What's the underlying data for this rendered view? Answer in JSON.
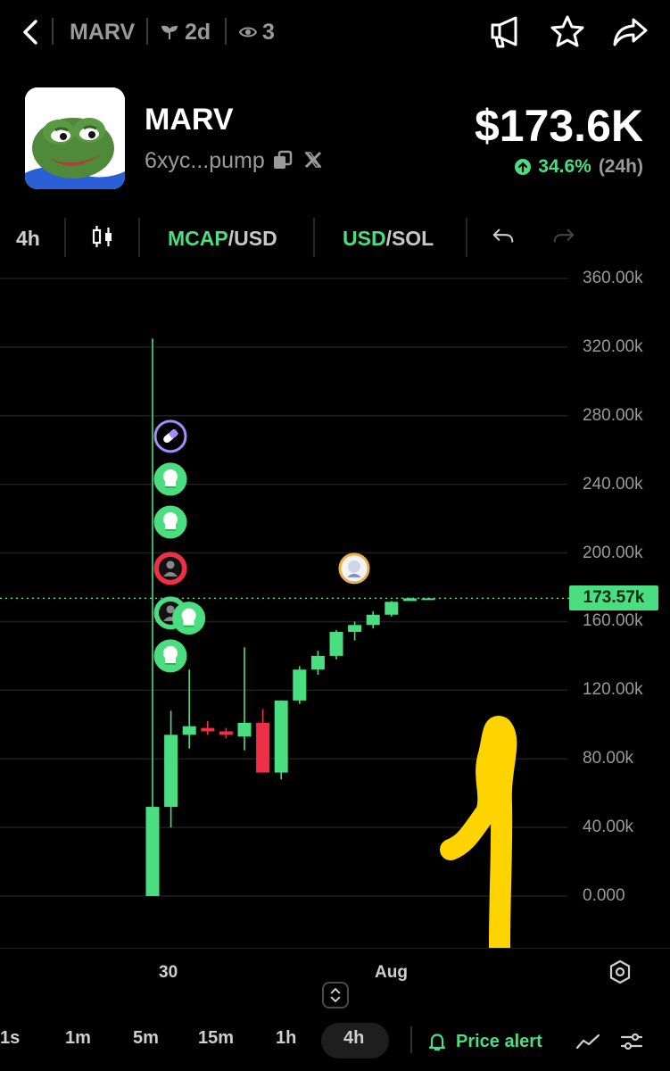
{
  "header": {
    "ticker": "MARV",
    "age": "2d",
    "watchers": "3"
  },
  "token": {
    "name": "MARV",
    "address": "6xyc...pump",
    "price": "$173.6K",
    "change_pct": "34.6%",
    "change_period": "(24h)"
  },
  "toolbar": {
    "interval": "4h",
    "mcap_label": "MCAP",
    "mcap_unit": "/USD",
    "usd_label": "USD",
    "usd_unit": "/SOL"
  },
  "chart_data": {
    "type": "candlestick",
    "y_unit": "market cap (USD)",
    "yticks": [
      "360.00k",
      "320.00k",
      "280.00k",
      "240.00k",
      "200.00k",
      "160.00k",
      "120.00k",
      "80.00k",
      "40.00k",
      "0.000"
    ],
    "ylim": [
      0,
      360000
    ],
    "x_labels": [
      "30",
      "Aug"
    ],
    "current_price_label": "173.57k",
    "current_price": 173570,
    "candles": [
      {
        "o": 0,
        "h": 325000,
        "l": 0,
        "c": 52000
      },
      {
        "o": 52000,
        "h": 108000,
        "l": 40000,
        "c": 94000
      },
      {
        "o": 94000,
        "h": 132000,
        "l": 86000,
        "c": 99000
      },
      {
        "o": 98000,
        "h": 102000,
        "l": 94000,
        "c": 96000
      },
      {
        "o": 96000,
        "h": 98000,
        "l": 92000,
        "c": 94000
      },
      {
        "o": 93000,
        "h": 145000,
        "l": 85000,
        "c": 101000
      },
      {
        "o": 101000,
        "h": 109000,
        "l": 72000,
        "c": 72000
      },
      {
        "o": 72000,
        "h": 114000,
        "l": 68000,
        "c": 114000
      },
      {
        "o": 114000,
        "h": 134000,
        "l": 112000,
        "c": 132000
      },
      {
        "o": 132000,
        "h": 143000,
        "l": 129000,
        "c": 140000
      },
      {
        "o": 140000,
        "h": 155000,
        "l": 138000,
        "c": 154000
      },
      {
        "o": 154000,
        "h": 160000,
        "l": 149000,
        "c": 158000
      },
      {
        "o": 158000,
        "h": 166000,
        "l": 156000,
        "c": 164000
      },
      {
        "o": 164000,
        "h": 172000,
        "l": 163000,
        "c": 171500
      },
      {
        "o": 172000,
        "h": 174000,
        "l": 172000,
        "c": 173570
      },
      {
        "o": 173570,
        "h": 174000,
        "l": 173570,
        "c": 173570
      }
    ],
    "colors": {
      "up": "#4ade80",
      "down": "#ef2f45"
    },
    "grid": true,
    "markers": [
      {
        "candle": 0,
        "value": 268000,
        "kind": "pill-icon",
        "color": "#a78bfa"
      },
      {
        "candle": 0,
        "value": 243000,
        "kind": "chef-icon",
        "color": "#4ade80"
      },
      {
        "candle": 0,
        "value": 218000,
        "kind": "chef-icon",
        "color": "#4ade80"
      },
      {
        "candle": 0,
        "value": 191000,
        "kind": "person-icon",
        "color": "#ef2f45"
      },
      {
        "candle": 0,
        "value": 165000,
        "kind": "person-icon",
        "color": "#4ade80"
      },
      {
        "candle": 1,
        "value": 162000,
        "kind": "chef-icon",
        "color": "#4ade80"
      },
      {
        "candle": 0,
        "value": 140000,
        "kind": "chef-icon",
        "color": "#4ade80"
      },
      {
        "candle": 10,
        "value": 191000,
        "kind": "avatar-icon",
        "color": "#e8b04a"
      }
    ],
    "annotation": {
      "kind": "hand-drawn-arrow",
      "color": "#fdd400",
      "direction": "down"
    }
  },
  "timeframes": [
    "1s",
    "1m",
    "5m",
    "15m",
    "1h",
    "4h"
  ],
  "active_timeframe": "4h",
  "price_alert_label": "Price alert"
}
